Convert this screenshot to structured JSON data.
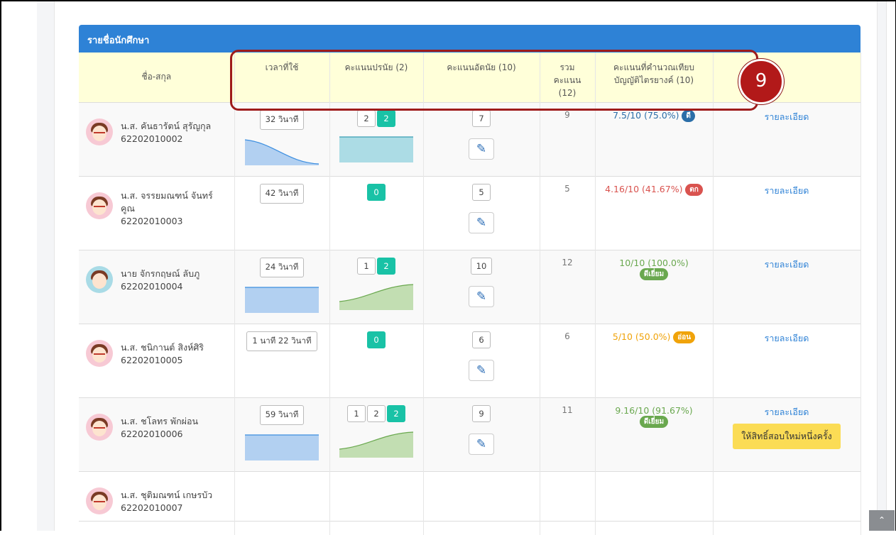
{
  "card_title": "รายชื่อนักศึกษา",
  "step_number": "9",
  "columns": {
    "name": "ชื่อ-สกุล",
    "time": "เวลาที่ใช้",
    "objective": "คะแนนปรนัย (2)",
    "subjective": "คะแนนอัตนัย (10)",
    "total_line1": "รวม",
    "total_line2": "คะแนน",
    "total_line3": "(12)",
    "calc_line1": "คะแนนที่คำนวณเทียบ",
    "calc_line2": "บัญญัติไตรยางค์ (10)"
  },
  "detail_label": "รายละเอียด",
  "retry_label": "ให้สิทธิ์สอบใหม่หนึ่งครั้ง",
  "colors": {
    "header_blue": "#2e82d6",
    "teal": "#19c2a6",
    "good_blue": "#2b6ea8",
    "fail_red": "#d9534f",
    "excellent_green": "#6aa84f",
    "weak_orange": "#f0a30a"
  },
  "students": [
    {
      "name_line1": "น.ส. คันธารัตน์ สุรัญกุล",
      "name_line2": "62202010002",
      "name_line3": "",
      "avatar": "girl-avatar",
      "time": "32 วินาที",
      "attempts": [
        "2",
        "2"
      ],
      "subjective": "7",
      "total": "9",
      "calc": "7.5/10 (75.0%)",
      "grade": "ดี",
      "grade_color": "#2b6ea8"
    },
    {
      "name_line1": "น.ส. จรรยมณฑน์ จันทร์",
      "name_line2": "คูณ",
      "name_line3": "62202010003",
      "avatar": "girl-avatar",
      "time": "42 วินาที",
      "attempts": [
        "0"
      ],
      "subjective": "5",
      "total": "5",
      "calc": "4.16/10 (41.67%)",
      "grade": "ตก",
      "grade_color": "#d9534f"
    },
    {
      "name_line1": "นาย จักรกฤษณ์ ลับภู",
      "name_line2": "62202010004",
      "name_line3": "",
      "avatar": "boy-avatar",
      "time": "24 วินาที",
      "attempts": [
        "1",
        "2"
      ],
      "subjective": "10",
      "total": "12",
      "calc": "10/10 (100.0%)",
      "grade": "ดีเยี่ยม",
      "grade_color": "#6aa84f"
    },
    {
      "name_line1": "น.ส. ชนิกานต์ สิงห์ศิริ",
      "name_line2": "62202010005",
      "name_line3": "",
      "avatar": "girl-avatar",
      "time": "1 นาที 22 วินาที",
      "attempts": [
        "0"
      ],
      "subjective": "6",
      "total": "6",
      "calc": "5/10 (50.0%)",
      "grade": "อ่อน",
      "grade_color": "#f0a30a"
    },
    {
      "name_line1": "น.ส. ชโลทร พักผ่อน",
      "name_line2": "62202010006",
      "name_line3": "",
      "avatar": "girl-avatar",
      "time": "59 วินาที",
      "attempts": [
        "1",
        "2",
        "2"
      ],
      "subjective": "9",
      "total": "11",
      "calc": "9.16/10 (91.67%)",
      "grade": "ดีเยี่ยม",
      "grade_color": "#6aa84f"
    },
    {
      "name_line1": "น.ส. ชุติมณฑน์ เกษรบัว",
      "name_line2": "62202010007",
      "name_line3": "",
      "avatar": "girl-avatar"
    }
  ]
}
